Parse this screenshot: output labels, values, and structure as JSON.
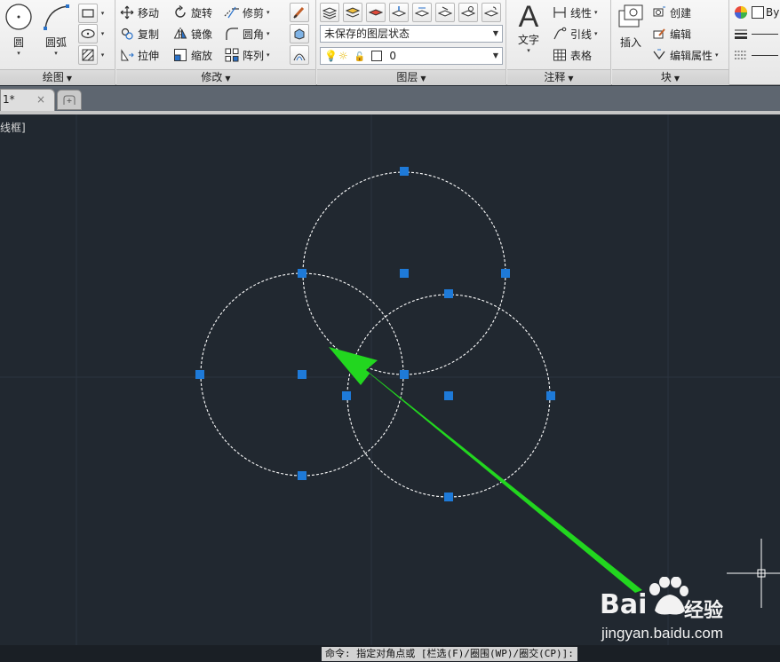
{
  "ribbon": {
    "draw": {
      "title": "绘图",
      "circle": "圆",
      "arc": "圆弧"
    },
    "modify": {
      "title": "修改",
      "move": "移动",
      "rotate": "旋转",
      "trim": "修剪",
      "copy": "复制",
      "mirror": "镜像",
      "fillet": "圆角",
      "stretch": "拉伸",
      "scale": "缩放",
      "array": "阵列"
    },
    "layers": {
      "title": "图层",
      "layer_state": "未保存的图层状态",
      "current_layer": "0"
    },
    "annotation": {
      "title": "注释",
      "text": "文字",
      "linear": "线性",
      "leader": "引线",
      "table": "表格"
    },
    "block": {
      "title": "块",
      "insert": "插入",
      "create": "创建",
      "edit": "编辑",
      "edit_attributes": "编辑属性"
    },
    "properties": {
      "color_value": "By"
    }
  },
  "tabs": {
    "drawing_tab": "1*",
    "close_glyph": "×"
  },
  "viewport": {
    "label": "线框]"
  },
  "command_line": {
    "text": "命令: 指定对角点或 [栏选(F)/圈围(WP)/圈交(CP)]:"
  },
  "watermark": {
    "brand": "Bai",
    "product": "经验",
    "url": "jingyan.baidu.com"
  },
  "icons": {
    "circle": "circle-icon",
    "arc": "arc-icon",
    "move": "move-icon",
    "rotate": "rotate-icon",
    "trim": "trim-icon",
    "copy": "copy-icon",
    "mirror": "mirror-icon",
    "fillet": "fillet-icon",
    "stretch": "stretch-icon",
    "scale": "scale-icon",
    "array": "array-icon",
    "arrow_annotation": "green-arrow"
  },
  "colors": {
    "canvas_bg": "#212830",
    "grip_blue": "#1e7ad8",
    "annotation_arrow": "#22d61f",
    "circle_stroke": "#ffffff"
  }
}
